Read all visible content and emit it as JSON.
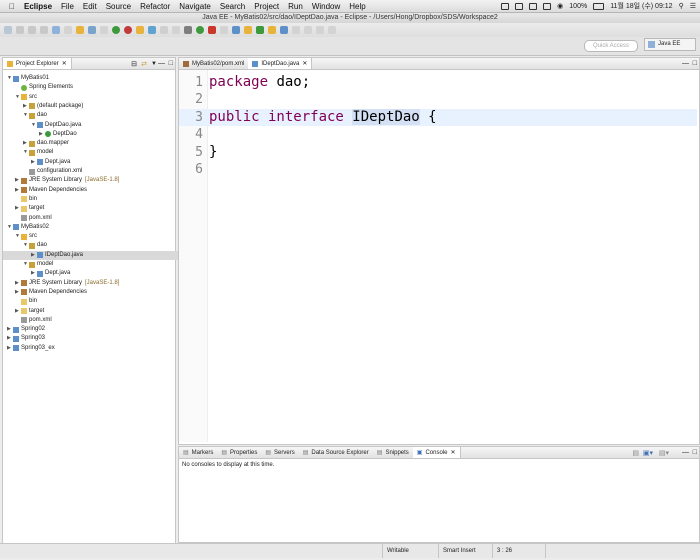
{
  "menubar": {
    "app": "Eclipse",
    "items": [
      "File",
      "Edit",
      "Source",
      "Refactor",
      "Navigate",
      "Search",
      "Project",
      "Run",
      "Window",
      "Help"
    ],
    "battery": "100%",
    "clock": "11월 18일 (수) 09:12"
  },
  "window": {
    "title": "Java EE - MyBatis02/src/dao/IDeptDao.java - Eclipse - /Users/Hong/Dropbox/SDS/Workspace2"
  },
  "quick_access": {
    "placeholder": "Quick Access"
  },
  "perspective": {
    "label": "Java EE"
  },
  "project_explorer": {
    "tab": "Project Explorer",
    "nodes": [
      {
        "label": "MyBatis01"
      },
      {
        "label": "Spring Elements"
      },
      {
        "label": "src"
      },
      {
        "label": "(default package)"
      },
      {
        "label": "dao"
      },
      {
        "label": "DeptDao.java"
      },
      {
        "label": "DeptDao"
      },
      {
        "label": "dao.mapper"
      },
      {
        "label": "model"
      },
      {
        "label": "Dept.java"
      },
      {
        "label": "configuration.xml"
      },
      {
        "label": "JRE System Library",
        "deco": "[JavaSE-1.8]"
      },
      {
        "label": "Maven Dependencies"
      },
      {
        "label": "bin"
      },
      {
        "label": "target"
      },
      {
        "label": "pom.xml"
      },
      {
        "label": "MyBatis02"
      },
      {
        "label": "src"
      },
      {
        "label": "dao"
      },
      {
        "label": "IDeptDao.java"
      },
      {
        "label": "model"
      },
      {
        "label": "Dept.java"
      },
      {
        "label": "JRE System Library",
        "deco": "[JavaSE-1.8]"
      },
      {
        "label": "Maven Dependencies"
      },
      {
        "label": "bin"
      },
      {
        "label": "target"
      },
      {
        "label": "pom.xml"
      },
      {
        "label": "Spring02"
      },
      {
        "label": "Spring03"
      },
      {
        "label": "Spring03_ex"
      }
    ]
  },
  "editor": {
    "tabs": [
      {
        "label": "MyBatis02/pom.xml"
      },
      {
        "label": "IDeptDao.java"
      }
    ],
    "lines": [
      {
        "n": "1",
        "code": "package dao;"
      },
      {
        "n": "2",
        "code": ""
      },
      {
        "n": "3",
        "kw": "public interface ",
        "hl": "IDeptDao",
        "rest": " {"
      },
      {
        "n": "4",
        "code": ""
      },
      {
        "n": "5",
        "code": "}"
      },
      {
        "n": "6",
        "code": ""
      }
    ]
  },
  "bottom": {
    "tabs": [
      "Markers",
      "Properties",
      "Servers",
      "Data Source Explorer",
      "Snippets",
      "Console"
    ],
    "message": "No consoles to display at this time."
  },
  "status": {
    "writable": "Writable",
    "insert": "Smart Insert",
    "position": "3 : 26"
  }
}
